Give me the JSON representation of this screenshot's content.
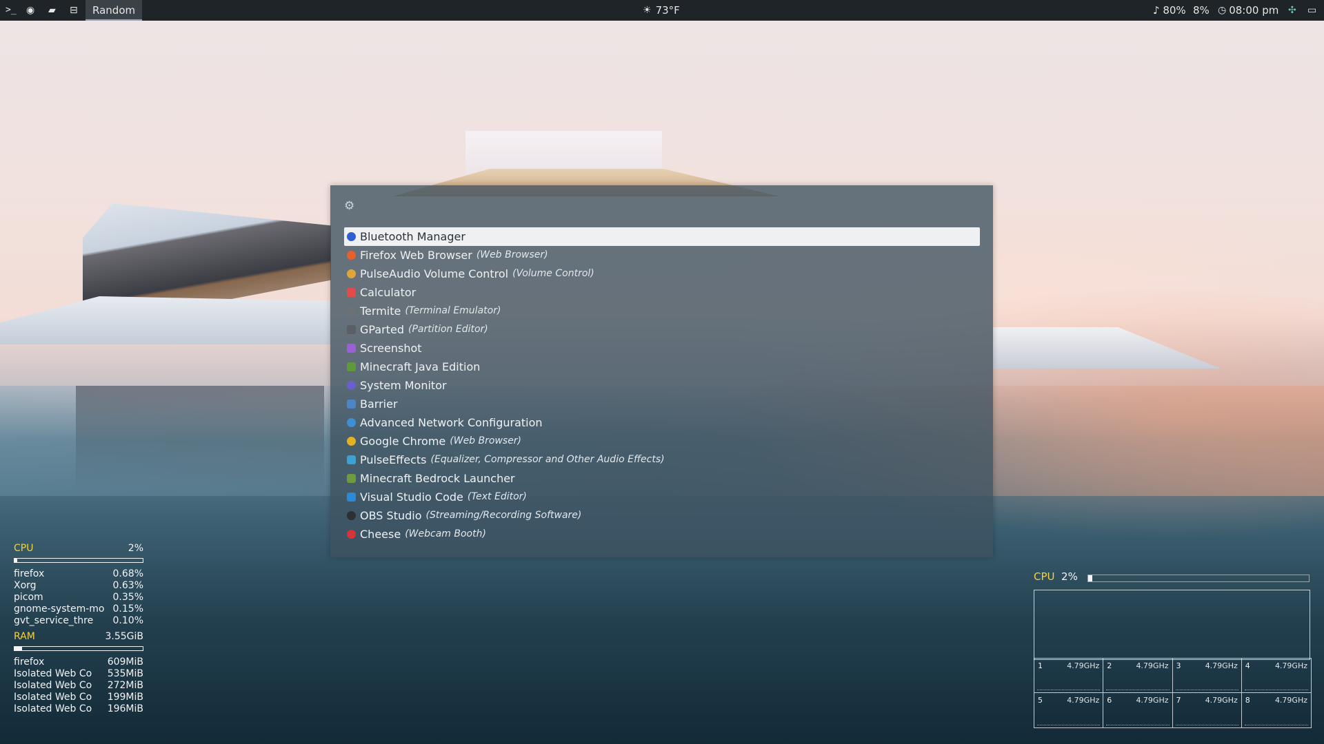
{
  "topbar": {
    "workspace_label": "Random",
    "weather": "73°F",
    "volume": "♪ 80%",
    "battery": "8%",
    "clock": "08:00 pm"
  },
  "launcher": {
    "items": [
      {
        "name": "Bluetooth Manager",
        "subtitle": "",
        "icon": "bluetooth-icon",
        "color": "#2f5fd0",
        "selected": true
      },
      {
        "name": "Firefox Web Browser",
        "subtitle": "(Web Browser)",
        "icon": "firefox-icon",
        "color": "#e8602c"
      },
      {
        "name": "PulseAudio Volume Control",
        "subtitle": "(Volume Control)",
        "icon": "pulseaudio-icon",
        "color": "#e0a537"
      },
      {
        "name": "Calculator",
        "subtitle": "",
        "icon": "calculator-icon",
        "color": "#e34b4b"
      },
      {
        "name": "Termite",
        "subtitle": "(Terminal Emulator)",
        "icon": "terminal-icon",
        "color": "#6b7177"
      },
      {
        "name": "GParted",
        "subtitle": "(Partition Editor)",
        "icon": "gparted-icon",
        "color": "#5a5f66"
      },
      {
        "name": "Screenshot",
        "subtitle": "",
        "icon": "screenshot-icon",
        "color": "#9b5fd6"
      },
      {
        "name": "Minecraft Java Edition",
        "subtitle": "",
        "icon": "minecraft-icon",
        "color": "#5f9a3a"
      },
      {
        "name": "System Monitor",
        "subtitle": "",
        "icon": "system-monitor-icon",
        "color": "#6a5fd0"
      },
      {
        "name": "Barrier",
        "subtitle": "",
        "icon": "barrier-icon",
        "color": "#4c86c6"
      },
      {
        "name": "Advanced Network Configuration",
        "subtitle": "",
        "icon": "network-icon",
        "color": "#3f8fd6"
      },
      {
        "name": "Google Chrome",
        "subtitle": "(Web Browser)",
        "icon": "chrome-icon",
        "color": "#e3b122"
      },
      {
        "name": "PulseEffects",
        "subtitle": "(Equalizer, Compressor and Other Audio Effects)",
        "icon": "pulseeffects-icon",
        "color": "#3aa3d6"
      },
      {
        "name": "Minecraft Bedrock Launcher",
        "subtitle": "",
        "icon": "minecraft-bedrock-icon",
        "color": "#6d9b3e"
      },
      {
        "name": "Visual Studio Code",
        "subtitle": "(Text Editor)",
        "icon": "vscode-icon",
        "color": "#2a8ad8"
      },
      {
        "name": "OBS Studio",
        "subtitle": "(Streaming/Recording Software)",
        "icon": "obs-icon",
        "color": "#2d2f33"
      },
      {
        "name": "Cheese",
        "subtitle": "(Webcam Booth)",
        "icon": "cheese-icon",
        "color": "#d8323a"
      }
    ]
  },
  "conky_left": {
    "cpu_label": "CPU",
    "cpu_value": "2%",
    "cpu_fraction": 0.02,
    "cpu_processes": [
      {
        "name": "firefox",
        "value": "0.68%"
      },
      {
        "name": "Xorg",
        "value": "0.63%"
      },
      {
        "name": "picom",
        "value": "0.35%"
      },
      {
        "name": "gnome-system-mo",
        "value": "0.15%"
      },
      {
        "name": "gvt_service_thre",
        "value": "0.10%"
      }
    ],
    "ram_label": "RAM",
    "ram_value": "3.55GiB",
    "ram_fraction": 0.06,
    "ram_processes": [
      {
        "name": "firefox",
        "value": "609MiB"
      },
      {
        "name": "Isolated Web Co",
        "value": "535MiB"
      },
      {
        "name": "Isolated Web Co",
        "value": "272MiB"
      },
      {
        "name": "Isolated Web Co",
        "value": "199MiB"
      },
      {
        "name": "Isolated Web Co",
        "value": "196MiB"
      }
    ]
  },
  "conky_right": {
    "cpu_label": "CPU",
    "cpu_value": "2%",
    "cpu_fraction": 0.02,
    "cores": [
      {
        "id": "1",
        "freq": "4.79GHz"
      },
      {
        "id": "2",
        "freq": "4.79GHz"
      },
      {
        "id": "3",
        "freq": "4.79GHz"
      },
      {
        "id": "4",
        "freq": "4.79GHz"
      },
      {
        "id": "5",
        "freq": "4.79GHz"
      },
      {
        "id": "6",
        "freq": "4.79GHz"
      },
      {
        "id": "7",
        "freq": "4.79GHz"
      },
      {
        "id": "8",
        "freq": "4.79GHz"
      }
    ]
  }
}
